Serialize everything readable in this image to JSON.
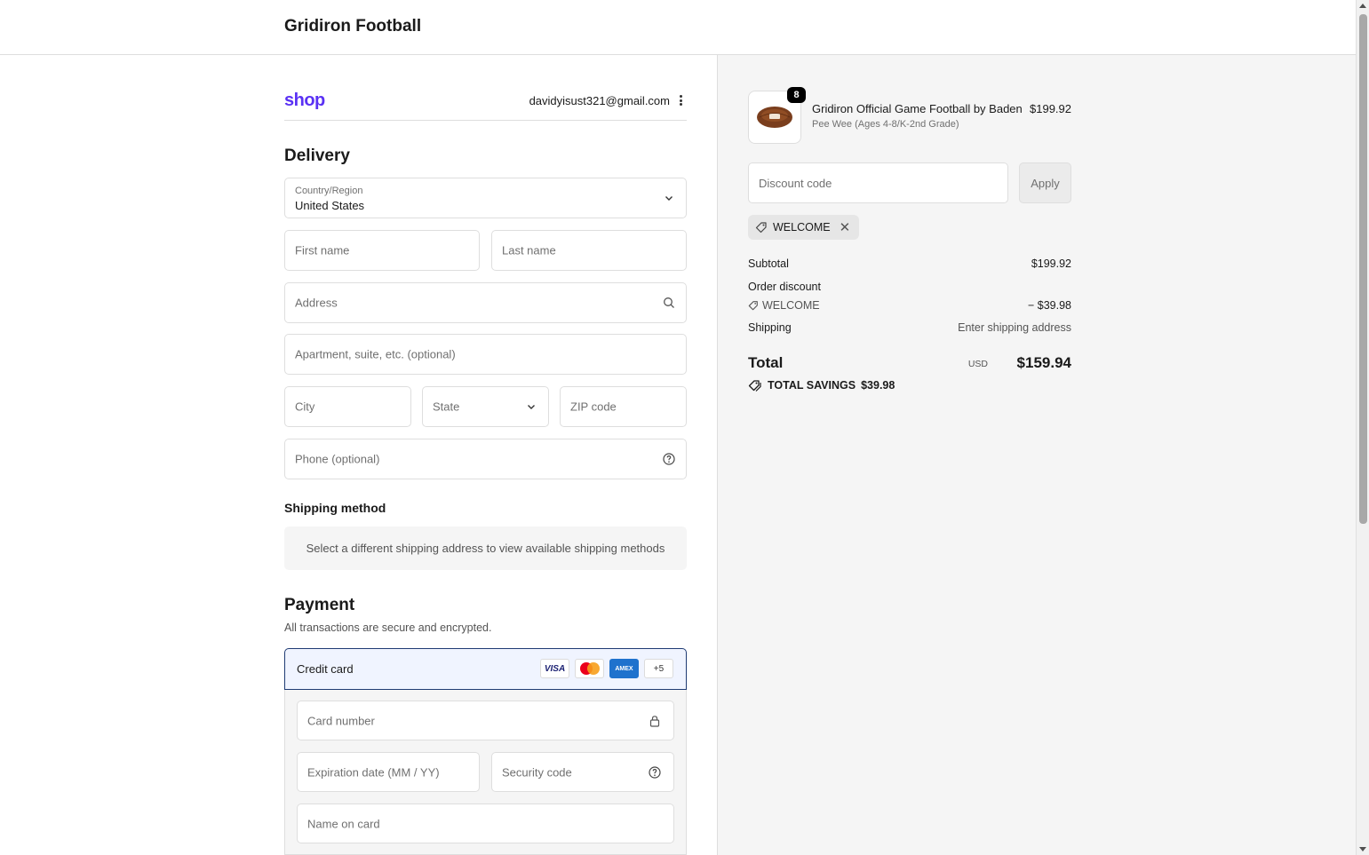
{
  "header": {
    "store_name": "Gridiron Football"
  },
  "account": {
    "logo": "shop",
    "email": "davidyisust321@gmail.com",
    "menu_icon": "kebab-menu-icon"
  },
  "delivery": {
    "title": "Delivery",
    "country_label": "Country/Region",
    "country_value": "United States",
    "first_name": "First name",
    "last_name": "Last name",
    "address": "Address",
    "apartment": "Apartment, suite, etc. (optional)",
    "city": "City",
    "state": "State",
    "zip": "ZIP code",
    "phone": "Phone (optional)"
  },
  "shipping_method": {
    "title": "Shipping method",
    "note": "Select a different shipping address to view available shipping methods"
  },
  "payment": {
    "title": "Payment",
    "subtitle": "All transactions are secure and encrypted.",
    "method": "Credit card",
    "logos": [
      "VISA",
      "Mastercard",
      "AMEX",
      "+5"
    ],
    "card_number": "Card number",
    "expiration": "Expiration date (MM / YY)",
    "security_code": "Security code",
    "name_on_card": "Name on card"
  },
  "summary": {
    "product": {
      "quantity": "8",
      "name": "Gridiron Official Game Football by Baden",
      "variant": "Pee Wee (Ages 4-8/K-2nd Grade)",
      "price": "$199.92"
    },
    "discount_placeholder": "Discount code",
    "apply_label": "Apply",
    "applied_code": "WELCOME",
    "subtotal_label": "Subtotal",
    "subtotal_value": "$199.92",
    "order_discount_label": "Order discount",
    "discount_code": "WELCOME",
    "discount_value": "− $39.98",
    "shipping_label": "Shipping",
    "shipping_value": "Enter shipping address",
    "total_label": "Total",
    "currency": "USD",
    "total_value": "$159.94",
    "savings_label": "TOTAL SAVINGS",
    "savings_value": "$39.98"
  },
  "colors": {
    "shop_brand": "#5a31f4",
    "selected_border": "#1f3b73",
    "summary_bg": "#f5f5f5"
  }
}
